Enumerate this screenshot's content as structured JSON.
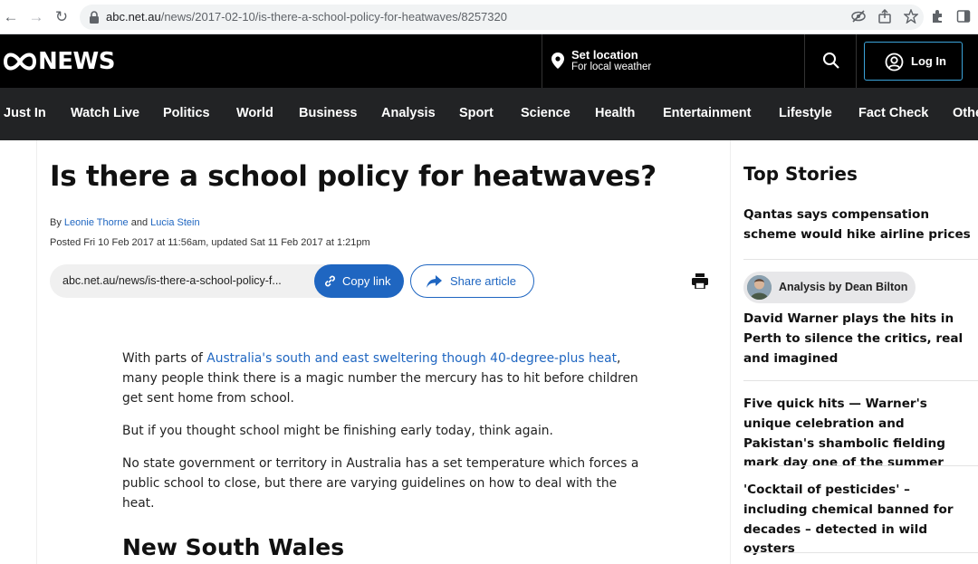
{
  "browser": {
    "url_host": "abc.net.au",
    "url_path": "/news/2017-02-10/is-there-a-school-policy-for-heatwaves/8257320"
  },
  "header": {
    "logo_text": "NEWS",
    "location_title": "Set location",
    "location_subtitle": "For local weather",
    "login_label": "Log In"
  },
  "nav": {
    "items": [
      "Just In",
      "Watch Live",
      "Politics",
      "World",
      "Business",
      "Analysis",
      "Sport",
      "Science",
      "Health",
      "Entertainment",
      "Lifestyle",
      "Fact Check",
      "Other"
    ]
  },
  "article": {
    "headline": "Is there a school policy for heatwaves?",
    "by_prefix": "By",
    "author1": "Leonie Thorne",
    "and": "and",
    "author2": "Lucia Stein",
    "posted": "Posted Fri 10 Feb 2017 at 11:56am, updated Sat 11 Feb 2017 at 1:21pm",
    "share_url": "abc.net.au/news/is-there-a-school-policy-f...",
    "copy_link": "Copy link",
    "share_article": "Share article",
    "p1_prefix": "With parts of",
    "p1_link": "Australia's south and east sweltering though 40-degree-plus heat",
    "p1_suffix": ", many people think there is a magic number the mercury has to hit before children get sent home from school.",
    "p2": "But if you thought school might be finishing early today, think again.",
    "p3": "No state government or territory in Australia has a set temperature which forces a public school to close, but there are varying guidelines on how to deal with the heat.",
    "subhead": "New South Wales"
  },
  "sidebar": {
    "title": "Top Stories",
    "story1": "Qantas says compensation scheme would hike airline prices",
    "analysis_label": "Analysis by Dean Bilton",
    "story2": "David Warner plays the hits in Perth to silence the critics, real and imagined",
    "story3": "Five quick hits — Warner's unique celebration and Pakistan's shambolic fielding mark day one of the summer",
    "story4": "'Cocktail of pesticides' – including chemical banned for decades – detected in wild oysters"
  }
}
